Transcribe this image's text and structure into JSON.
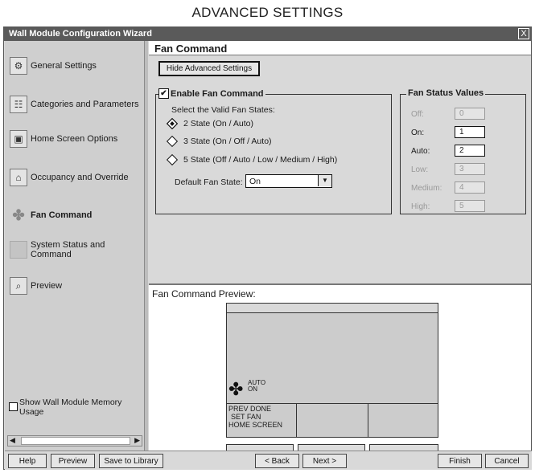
{
  "caption": "ADVANCED SETTINGS",
  "window": {
    "title": "Wall Module Configuration Wizard",
    "close_label": "X"
  },
  "sidebar": {
    "items": [
      {
        "label": "General Settings",
        "icon": "settings-icon"
      },
      {
        "label": "Categories and Parameters",
        "icon": "categories-icon"
      },
      {
        "label": "Home Screen Options",
        "icon": "home-screen-icon"
      },
      {
        "label": "Occupancy and Override",
        "icon": "occupancy-icon"
      },
      {
        "label": "Fan Command",
        "icon": "fan-icon"
      },
      {
        "label": "System Status and Command",
        "icon": "system-status-icon"
      },
      {
        "label": "Preview",
        "icon": "preview-icon"
      }
    ],
    "active_index": 4,
    "memory_checkbox_label": "Show Wall Module Memory Usage",
    "memory_checked": false
  },
  "main": {
    "title": "Fan Command",
    "hide_advanced_label": "Hide Advanced Settings",
    "enable_group": {
      "label": "Enable Fan Command",
      "checked": true,
      "select_prompt": "Select the Valid Fan States:",
      "options": [
        "2 State (On / Auto)",
        "3 State (On / Off / Auto)",
        "5 State (Off / Auto / Low / Medium / High)"
      ],
      "selected_index": 0,
      "default_label": "Default Fan State:",
      "default_value": "On"
    },
    "status_group": {
      "label": "Fan Status Values",
      "rows": [
        {
          "label": "Off:",
          "value": "0",
          "enabled": false
        },
        {
          "label": "On:",
          "value": "1",
          "enabled": true
        },
        {
          "label": "Auto:",
          "value": "2",
          "enabled": true
        },
        {
          "label": "Low:",
          "value": "3",
          "enabled": false
        },
        {
          "label": "Medium:",
          "value": "4",
          "enabled": false
        },
        {
          "label": "High:",
          "value": "5",
          "enabled": false
        }
      ]
    },
    "preview": {
      "label": "Fan Command Preview:",
      "fan_auto": "AUTO",
      "fan_on": "ON",
      "soft_key_line1": "PREV DONE",
      "soft_key_line2": "SET  FAN",
      "soft_key_line3": "HOME SCREEN"
    }
  },
  "footer": {
    "help": "Help",
    "preview": "Preview",
    "save": "Save to Library",
    "back": "< Back",
    "next": "Next >",
    "finish": "Finish",
    "cancel": "Cancel"
  },
  "colors": {
    "titlebar": "#5a5a5a",
    "panel": "#d9d9d9",
    "sidebar": "#cfcfcf"
  }
}
